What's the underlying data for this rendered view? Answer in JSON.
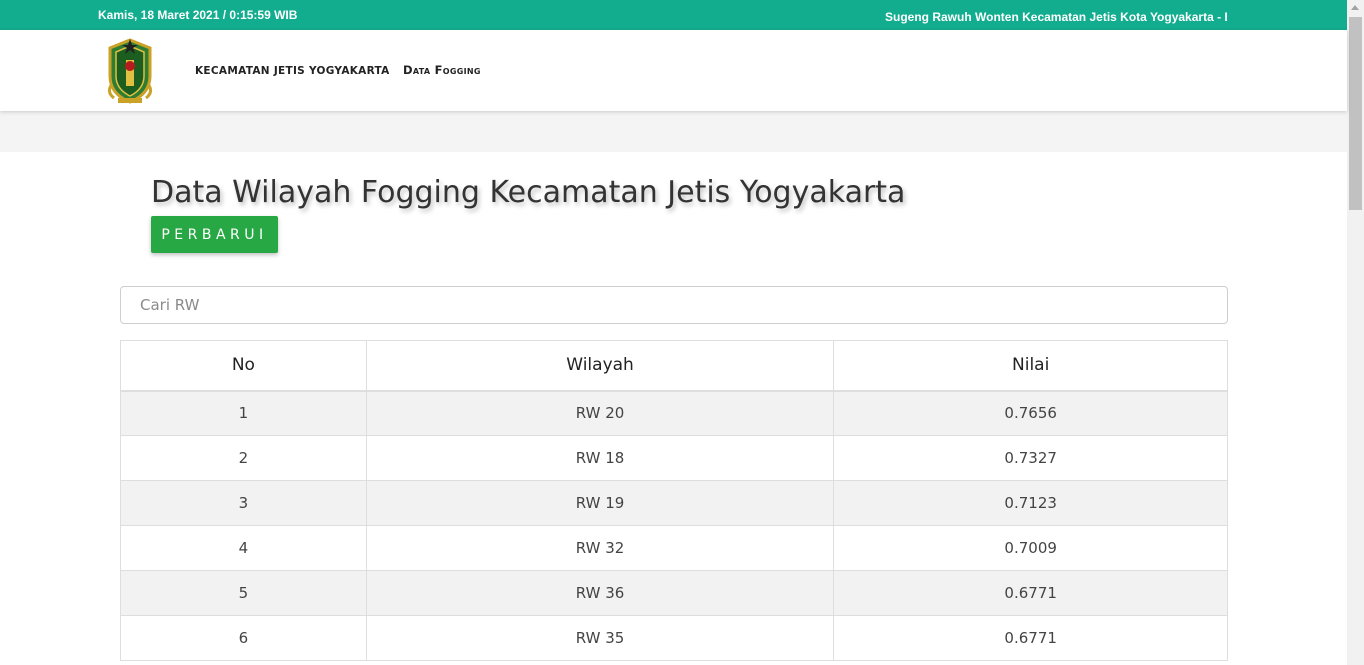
{
  "topbar": {
    "datetime": "Kamis, 18 Maret 2021 / 0:15:59 WIB",
    "marquee": "Sugeng Rawuh Wonten Kecamatan Jetis Kota Yogyakarta - Rel"
  },
  "nav": {
    "home": "KECAMATAN JETIS YOGYAKARTA",
    "fogging": "Data Fogging"
  },
  "page": {
    "title": "Data Wilayah Fogging Kecamatan Jetis Yogyakarta",
    "update_button": "PERBARUI"
  },
  "search": {
    "placeholder": "Cari RW"
  },
  "table": {
    "headers": [
      "No",
      "Wilayah",
      "Nilai"
    ],
    "rows": [
      [
        "1",
        "RW 20",
        "0.7656"
      ],
      [
        "2",
        "RW 18",
        "0.7327"
      ],
      [
        "3",
        "RW 19",
        "0.7123"
      ],
      [
        "4",
        "RW 32",
        "0.7009"
      ],
      [
        "5",
        "RW 36",
        "0.6771"
      ],
      [
        "6",
        "RW 35",
        "0.6771"
      ]
    ]
  },
  "colors": {
    "topbar": "#12ad8f",
    "button": "#27a844"
  },
  "icons": {
    "logo": "yogyakarta-crest-icon"
  }
}
